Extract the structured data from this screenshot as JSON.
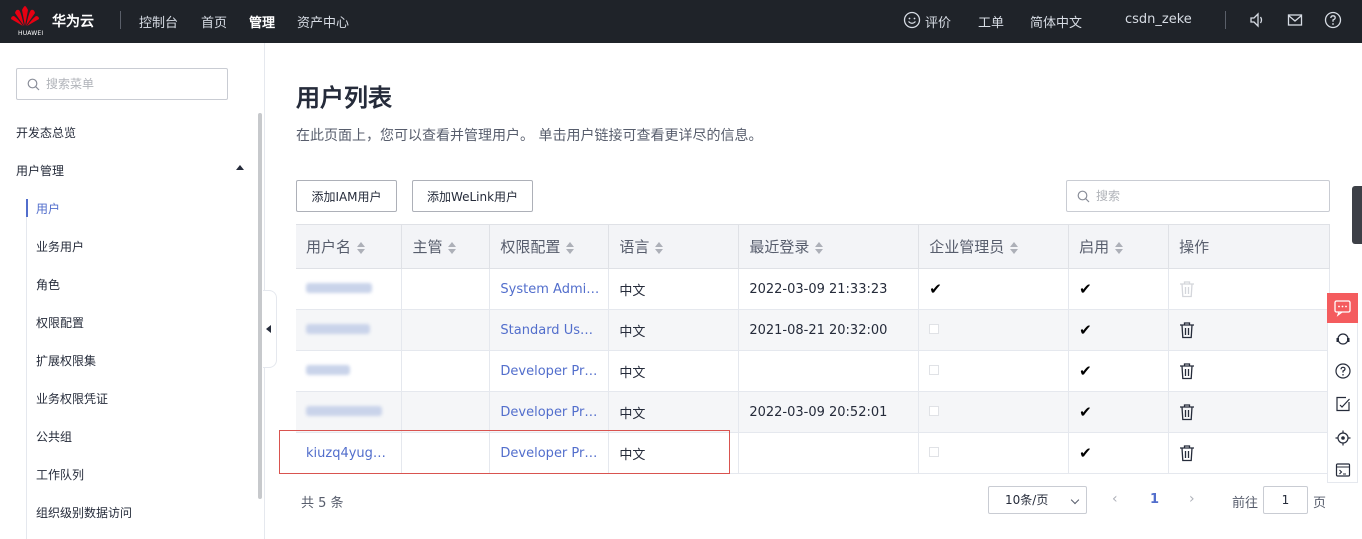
{
  "topbar": {
    "logo_text": "HUAWEI",
    "brand": "华为云",
    "nav": [
      "控制台",
      "首页",
      "管理",
      "资产中心"
    ],
    "active_nav": "管理",
    "right": {
      "rating": "评价",
      "ticket": "工单",
      "language": "简体中文",
      "username": "csdn_zeke"
    }
  },
  "sidebar": {
    "search_placeholder": "搜索菜单",
    "overview": "开发态总览",
    "user_mgmt": "用户管理",
    "items": [
      "用户",
      "业务用户",
      "角色",
      "权限配置",
      "扩展权限集",
      "业务权限凭证",
      "公共组",
      "工作队列",
      "组织级别数据访问"
    ],
    "active_item": "用户"
  },
  "main": {
    "title": "用户列表",
    "description": "在此页面上，您可以查看并管理用户。 单击用户链接可查看更详尽的信息。",
    "add_iam_button": "添加IAM用户",
    "add_welink_button": "添加WeLink用户",
    "search_placeholder": "搜索"
  },
  "table": {
    "columns": [
      "用户名",
      "主管",
      "权限配置",
      "语言",
      "最近登录",
      "企业管理员",
      "启用",
      "操作"
    ],
    "rows": [
      {
        "username": "",
        "supervisor": "",
        "permission": "System Admi…",
        "language": "中文",
        "last_login": "2022-03-09 21:33:23",
        "is_admin": true,
        "enabled": true,
        "delete_disabled": true
      },
      {
        "username": "",
        "supervisor": "",
        "permission": "Standard Us…",
        "language": "中文",
        "last_login": "2021-08-21 20:32:00",
        "is_admin": false,
        "enabled": true,
        "delete_disabled": false
      },
      {
        "username": "",
        "supervisor": "",
        "permission": "Developer Pr…",
        "language": "中文",
        "last_login": "",
        "is_admin": false,
        "enabled": true,
        "delete_disabled": false
      },
      {
        "username": "",
        "supervisor": "",
        "permission": "Developer Pr…",
        "language": "中文",
        "last_login": "2022-03-09 20:52:01",
        "is_admin": false,
        "enabled": true,
        "delete_disabled": false
      },
      {
        "username": "kiuzq4yug…",
        "supervisor": "",
        "permission": "Developer Pr…",
        "language": "中文",
        "last_login": "",
        "is_admin": false,
        "enabled": true,
        "delete_disabled": false
      }
    ]
  },
  "pagination": {
    "total": "共 5 条",
    "page_size": "10条/页",
    "current_page": "1",
    "goto_label": "前往",
    "goto_value": "1",
    "goto_unit": "页"
  },
  "colors": {
    "topbar_bg": "#1f2329",
    "link": "#526ecc",
    "highlight_border": "#d9534f",
    "float_accent": "#f45c5e"
  }
}
